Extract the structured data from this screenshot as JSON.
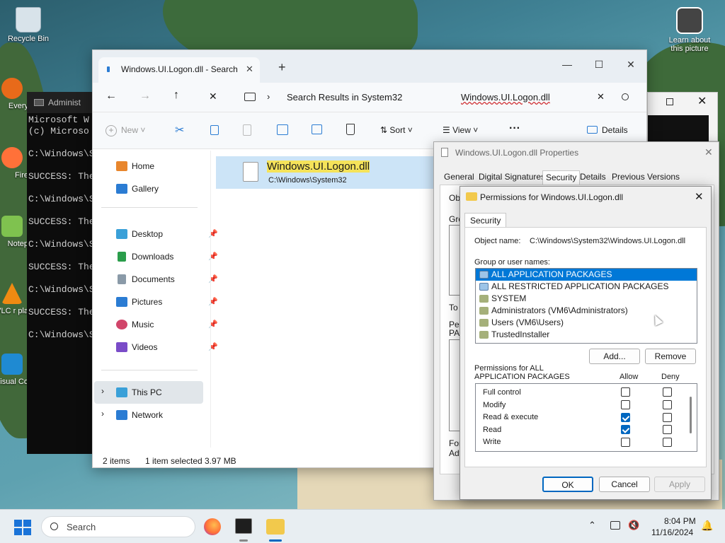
{
  "desktop": {
    "icons": [
      {
        "label": "Recycle Bin"
      },
      {
        "label": "Every"
      },
      {
        "label": "Fire"
      },
      {
        "label": "Notep"
      },
      {
        "label": "VLC r pla"
      },
      {
        "label": "Visual Co"
      }
    ],
    "learn_label": "Learn about this picture"
  },
  "terminal": {
    "title": "Administ",
    "lines": [
      "Microsoft W",
      "(c) Microso",
      "",
      "C:\\Windows\\S",
      "",
      "SUCCESS: The",
      "",
      "C:\\Windows\\S",
      "",
      "SUCCESS: The",
      "",
      "C:\\Windows\\S",
      "",
      "SUCCESS: The",
      "",
      "C:\\Windows\\S",
      "",
      "SUCCESS: The",
      "",
      "C:\\Windows\\S"
    ]
  },
  "explorer": {
    "tab_title": "Windows.UI.Logon.dll - Search",
    "breadcrumb": "Search Results in System32",
    "search_value": "Windows.UI.Logon.dll",
    "toolbar": {
      "new": "New",
      "sort": "Sort",
      "view": "View",
      "more": "···",
      "details": "Details"
    },
    "nav": {
      "home": "Home",
      "gallery": "Gallery",
      "desktop": "Desktop",
      "downloads": "Downloads",
      "documents": "Documents",
      "pictures": "Pictures",
      "music": "Music",
      "videos": "Videos",
      "thispc": "This PC",
      "network": "Network"
    },
    "file": {
      "name": "Windows.UI.Logon.dll",
      "path": "C:\\Windows\\System32"
    },
    "status": {
      "items": "2 items",
      "selected": "1 item selected",
      "size": "3.97 MB"
    }
  },
  "properties": {
    "title": "Windows.UI.Logon.dll Properties",
    "tabs": [
      "General",
      "Digital Signatures",
      "Security",
      "Details",
      "Previous Versions"
    ],
    "frag": {
      "obj": "Obj",
      "gro": "Gro",
      "to": "To",
      "per": "Per",
      "pac": "PAC",
      "for": "For",
      "adv": "Adv"
    }
  },
  "permissions": {
    "title": "Permissions for Windows.UI.Logon.dll",
    "tab": "Security",
    "object_label": "Object name:",
    "object_value": "C:\\Windows\\System32\\Windows.UI.Logon.dll",
    "group_label": "Group or user names:",
    "groups": [
      "ALL APPLICATION PACKAGES",
      "ALL RESTRICTED APPLICATION PACKAGES",
      "SYSTEM",
      "Administrators (VM6\\Administrators)",
      "Users (VM6\\Users)",
      "TrustedInstaller"
    ],
    "add": "Add...",
    "remove": "Remove",
    "perm_label_1": "Permissions for ALL",
    "perm_label_2": "APPLICATION PACKAGES",
    "allow": "Allow",
    "deny": "Deny",
    "rows": [
      {
        "name": "Full control",
        "allow": false,
        "deny": false
      },
      {
        "name": "Modify",
        "allow": false,
        "deny": false
      },
      {
        "name": "Read & execute",
        "allow": true,
        "deny": false
      },
      {
        "name": "Read",
        "allow": true,
        "deny": false
      },
      {
        "name": "Write",
        "allow": false,
        "deny": false
      }
    ],
    "ok": "OK",
    "cancel": "Cancel",
    "apply": "Apply"
  },
  "taskbar": {
    "search": "Search",
    "time": "8:04 PM",
    "date": "11/16/2024"
  }
}
